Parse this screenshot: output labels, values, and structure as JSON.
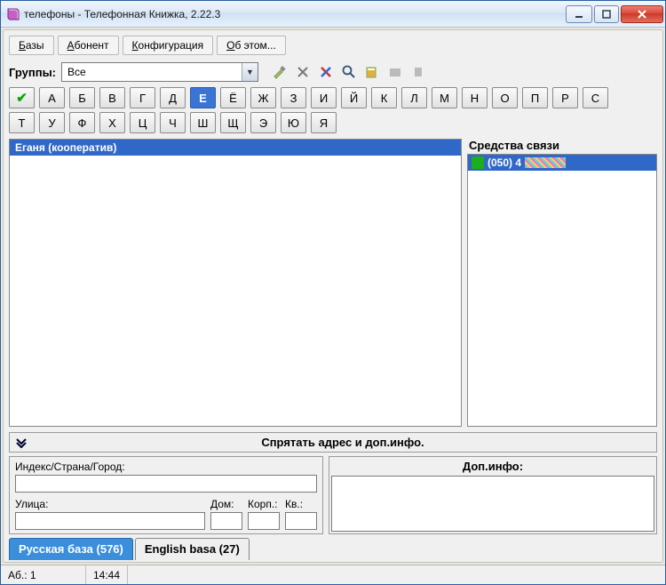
{
  "titlebar": {
    "title": "телефоны - Телефонная Книжка, 2.22.3"
  },
  "menu": {
    "bases": "Базы",
    "abonent": "Абонент",
    "config": "Конфигурация",
    "about": "Об этом..."
  },
  "menu_keys": {
    "bases": "Б",
    "abonent": "А",
    "config": "К",
    "about": "О"
  },
  "groups": {
    "label": "Группы:",
    "selected": "Все"
  },
  "alphabet": {
    "row1": [
      "А",
      "Б",
      "В",
      "Г",
      "Д",
      "Е",
      "Ё",
      "Ж",
      "З",
      "И",
      "Й",
      "К",
      "Л",
      "М",
      "Н",
      "О",
      "П",
      "Р",
      "С"
    ],
    "row2": [
      "Т",
      "У",
      "Ф",
      "Х",
      "Ц",
      "Ч",
      "Ш",
      "Щ",
      "Э",
      "Ю",
      "Я"
    ],
    "selected": "Е"
  },
  "contacts": {
    "selected": "Еганя (кооператив)"
  },
  "comm": {
    "title": "Средства связи",
    "phone": "(050) 4"
  },
  "hidebar": {
    "label": "Спрятать адрес и доп.инфо."
  },
  "addr": {
    "index_label": "Индекс/Страна/Город:",
    "index_value": "",
    "street_label": "Улица:",
    "street_value": "",
    "house_label": "Дом:",
    "house_value": "",
    "korp_label": "Корп.:",
    "korp_value": "",
    "flat_label": "Кв.:",
    "flat_value": ""
  },
  "dop": {
    "title": "Доп.инфо:"
  },
  "tabs": {
    "ru": "Русская база (576)",
    "en": "English basa (27)"
  },
  "status": {
    "ab": "Аб.: 1",
    "time": "14:44"
  }
}
